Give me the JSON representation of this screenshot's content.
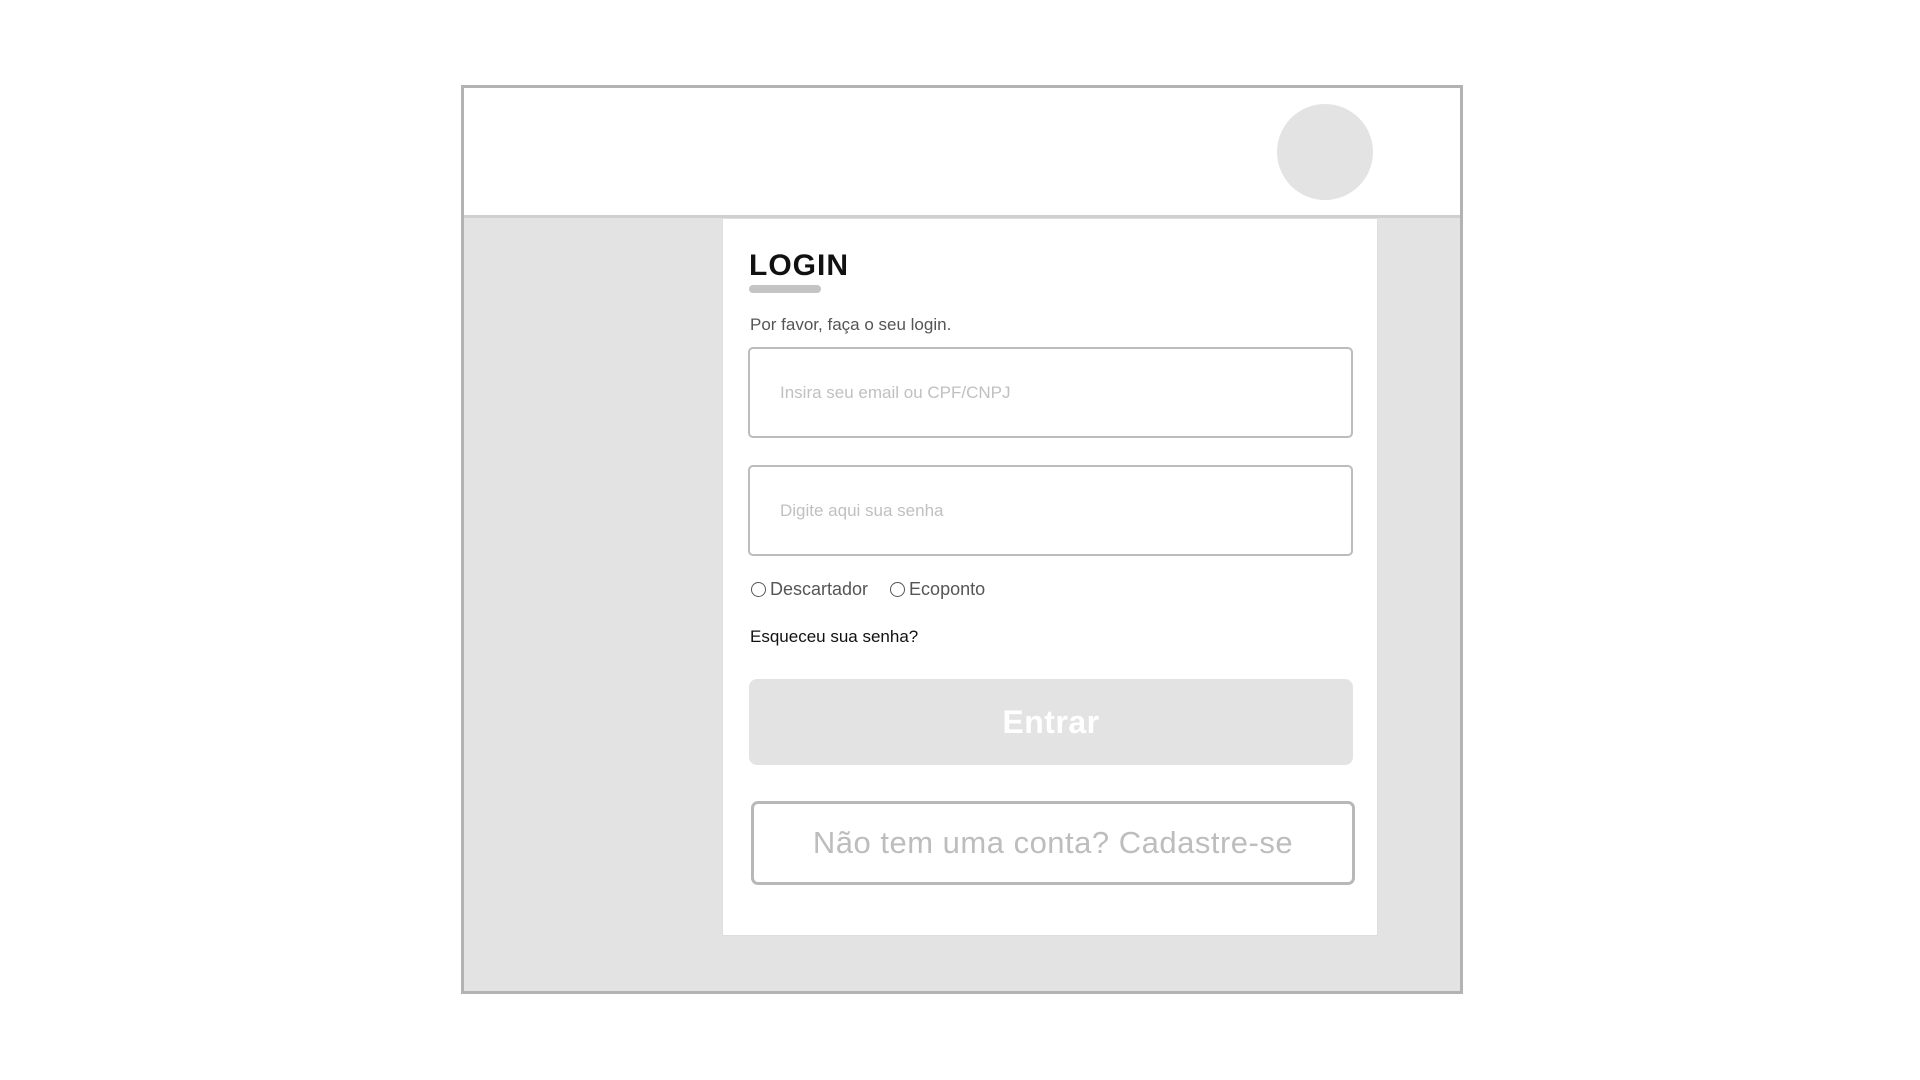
{
  "login": {
    "title": "LOGIN",
    "subtitle": "Por favor, faça o seu login.",
    "email_placeholder": "Insira seu email ou CPF/CNPJ",
    "email_value": "",
    "password_placeholder": "Digite aqui sua senha",
    "password_value": "",
    "user_types": [
      {
        "label": "Descartador",
        "selected": false
      },
      {
        "label": "Ecoponto",
        "selected": false
      }
    ],
    "forgot_password": "Esqueceu sua senha?",
    "enter_button": "Entrar",
    "register_button": "Não tem uma conta? Cadastre-se"
  },
  "colors": {
    "background": "#e3e3e3",
    "card": "#ffffff",
    "border": "#b3b3b3",
    "button_disabled": "#e3e3e3"
  }
}
